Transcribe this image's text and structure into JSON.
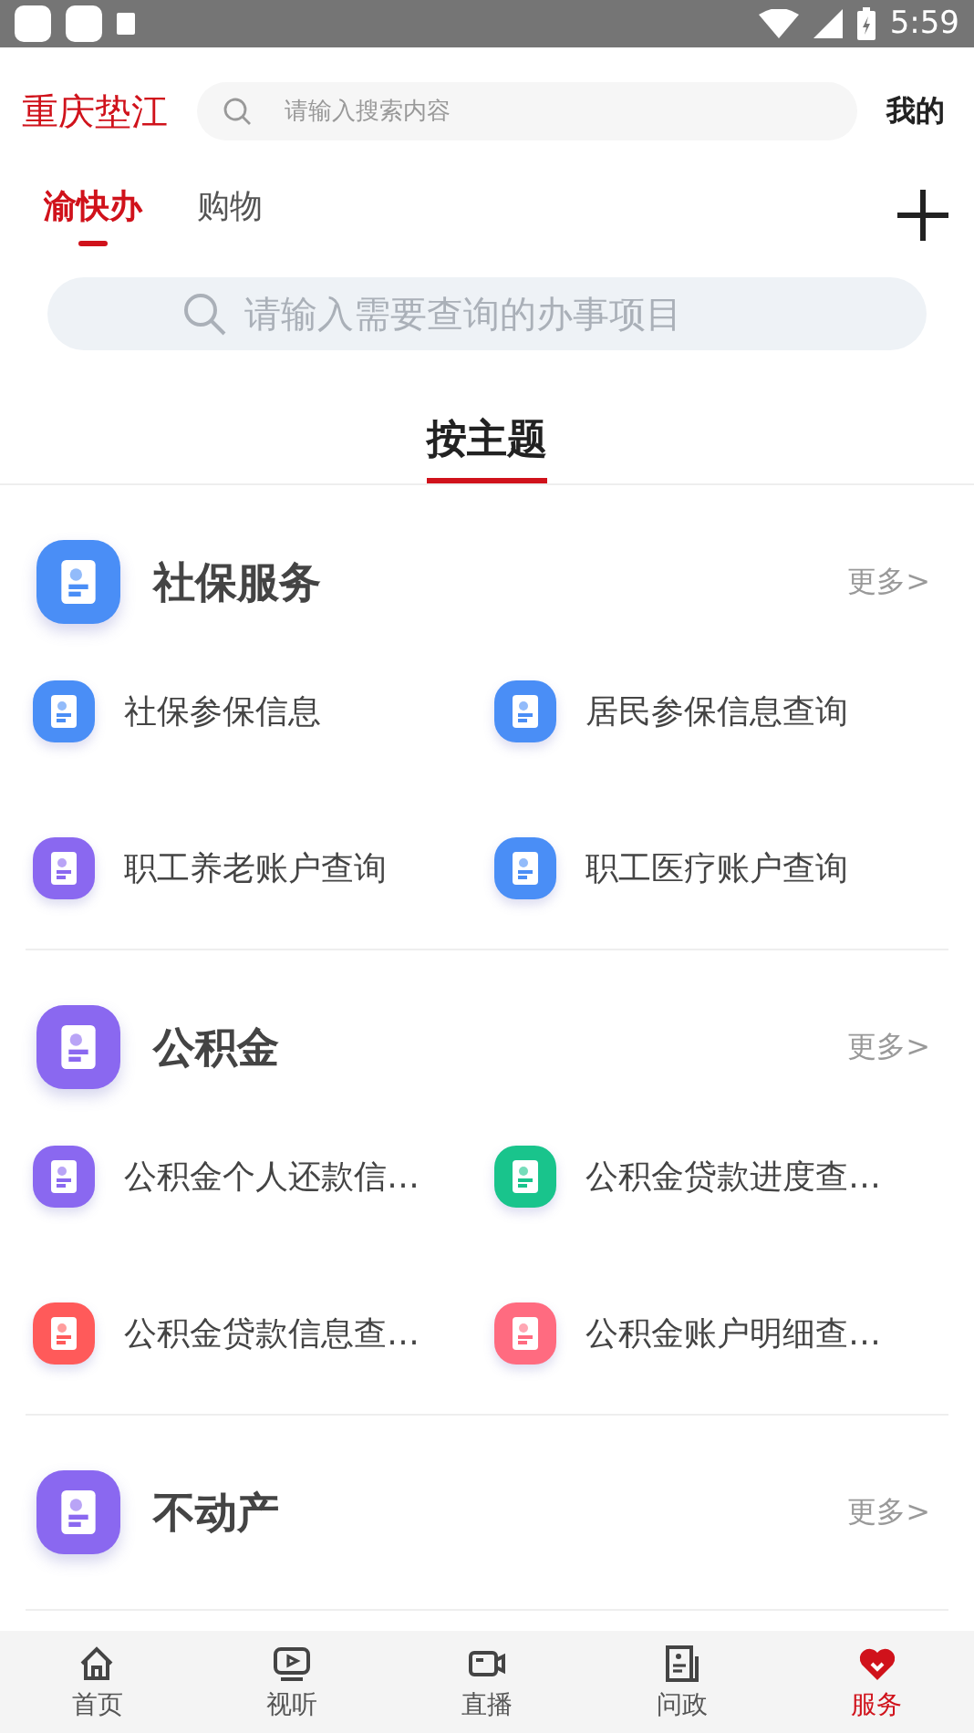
{
  "status_bar": {
    "time": "5:59"
  },
  "header": {
    "logo": "重庆垫江",
    "search": {
      "placeholder": "请输入搜索内容"
    },
    "profile": "我的"
  },
  "tabs": [
    {
      "label": "渝快办",
      "selected": true
    },
    {
      "label": "购物",
      "selected": false
    }
  ],
  "service_search": {
    "placeholder": "请输入需要查询的办事项目"
  },
  "section_title": "按主题",
  "groups": [
    {
      "title": "社保服务",
      "color": "#4a8ef6",
      "more": "更多>",
      "items": [
        {
          "label": "社保参保信息",
          "color": "#4a8ef6"
        },
        {
          "label": "居民参保信息查询",
          "color": "#4a8ef6"
        },
        {
          "label": "职工养老账户查询",
          "color": "#8a68f0"
        },
        {
          "label": "职工医疗账户查询",
          "color": "#4a8ef6"
        }
      ]
    },
    {
      "title": "公积金",
      "color": "#8a68f0",
      "more": "更多>",
      "items": [
        {
          "label": "公积金个人还款信…",
          "color": "#8a68f0"
        },
        {
          "label": "公积金贷款进度查…",
          "color": "#19c48c"
        },
        {
          "label": "公积金贷款信息查…",
          "color": "#ff5a5a"
        },
        {
          "label": "公积金账户明细查…",
          "color": "#ff6b80"
        }
      ]
    },
    {
      "title": "不动产",
      "color": "#8a68f0",
      "more": "更多>"
    }
  ],
  "bottom_nav": [
    {
      "label": "首页",
      "kind": "home",
      "selected": false
    },
    {
      "label": "视听",
      "kind": "video",
      "selected": false
    },
    {
      "label": "直播",
      "kind": "camera",
      "selected": false
    },
    {
      "label": "问政",
      "kind": "document",
      "selected": false
    },
    {
      "label": "服务",
      "kind": "heart",
      "selected": true
    }
  ]
}
